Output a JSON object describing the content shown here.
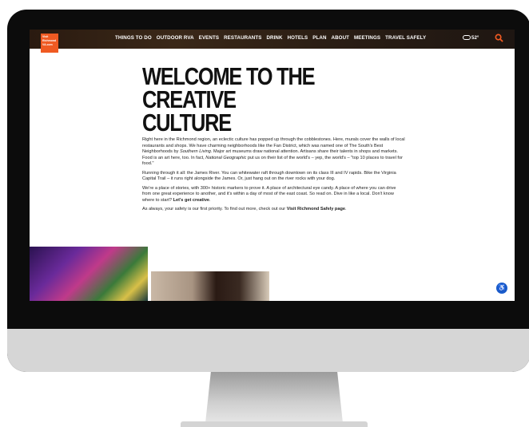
{
  "logo": {
    "lines": [
      "Visit",
      "Richmond",
      "VA.com"
    ]
  },
  "nav": {
    "items": [
      "THINGS TO DO",
      "OUTDOOR RVA",
      "EVENTS",
      "RESTAURANTS",
      "DRINK",
      "HOTELS",
      "PLAN",
      "ABOUT",
      "MEETINGS",
      "TRAVEL SAFELY"
    ],
    "weather": "52°"
  },
  "main": {
    "title_line1": "WELCOME TO THE CREATIVE",
    "title_line2": "CULTURE",
    "p1_a": "Right here in the Richmond region, an eclectic culture has popped up through the cobblestones. Here, murals cover the walls of local restaurants and shops. We have charming neighborhoods like the Fan District, which was named one of The South's Best Neighborhoods by ",
    "p1_em1": "Southern Living",
    "p1_b": ". Major art museums draw national attention. Artisans share their talents in shops and markets. Food is an art here, too. In fact, ",
    "p1_em2": "National Geographic",
    "p1_c": " put us on their list of the world's – yep, the world's – \"top 10 places to travel for food.\"",
    "p2": "Running through it all: the James River. You can whitewater raft through downtown on its class III and IV rapids. Bike the Virginia Capital Trail – it runs right alongside the James. Or, just hang out on the river rocks with your dog.",
    "p3": "We're a place of stories, with 300+ historic markers to prove it. A place of architectural eye candy. A place of where you can drive from one great experience to another, and it's within a day of most of the east coast. So read on. Dive in like a local. Don't know where to start? ",
    "p3_link": "Let's get creative",
    "p3_end": ".",
    "p4": "As always, your safety is our first priority. To find out more, check out our ",
    "p4_link": "Visit Richmond Safely page",
    "p4_end": "."
  },
  "colors": {
    "brand": "#f05a22",
    "accessibility": "#1a5ccc"
  }
}
